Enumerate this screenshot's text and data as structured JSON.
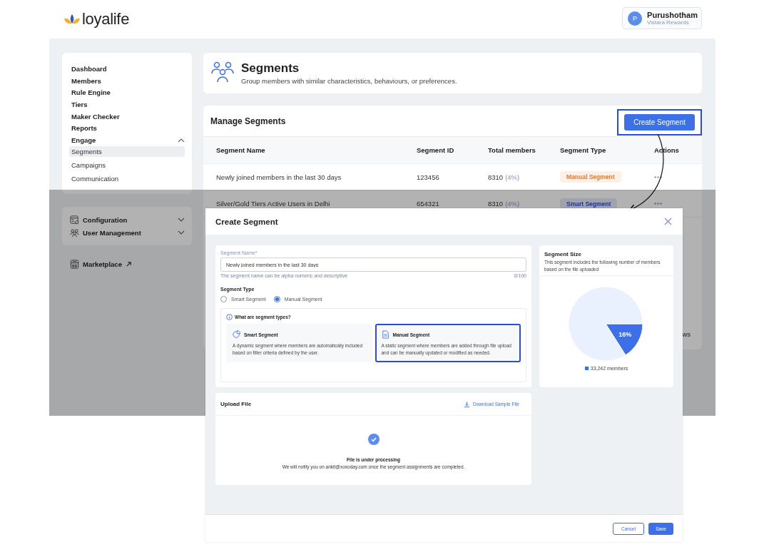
{
  "header": {
    "logo": "loyalife",
    "user": {
      "initial": "P",
      "name": "Purushotham",
      "org": "Vistara Rewards"
    }
  },
  "sidebar": {
    "items": [
      {
        "label": "Dashboard"
      },
      {
        "label": "Members"
      },
      {
        "label": "Rule Engine"
      },
      {
        "label": "Tiers"
      },
      {
        "label": "Maker Checker"
      },
      {
        "label": "Reports"
      },
      {
        "label": "Engage",
        "expanded": true,
        "children": [
          {
            "label": "Segments",
            "selected": true
          },
          {
            "label": "Campaigns",
            "selected": false
          },
          {
            "label": "Communication",
            "selected": false
          }
        ]
      }
    ],
    "settings": [
      {
        "label": "Configuration",
        "kind": "config",
        "expanded": false
      },
      {
        "label": "User Management",
        "kind": "users",
        "expanded": false
      }
    ],
    "marketplace": "Marketplace"
  },
  "page": {
    "title": "Segments",
    "subtitle": "Group members with similar characteristics, behaviours, or preferences."
  },
  "table": {
    "title": "Manage Segments",
    "create_button": "Create Segment",
    "columns": [
      "Segment Name",
      "Segment ID",
      "Total members",
      "Segment Type",
      "Actions"
    ],
    "rows": [
      {
        "name": "Newly joined members in the last 30 days",
        "id": "123456",
        "total": "8310",
        "share": "(4%)",
        "type": {
          "kind": "manual",
          "label": "Manual Segment"
        }
      },
      {
        "name": "Silver/Gold Tiers Active Users in Delhi",
        "id": "654321",
        "total": "8310",
        "share": "(4%)",
        "type": {
          "kind": "smart",
          "label": "Smart Segment"
        }
      }
    ],
    "footer_fragment": "ws"
  },
  "modal": {
    "title": "Create Segment",
    "name_field": {
      "label": "Segment Name*",
      "value": "Newly joined members in the last 30 days",
      "hint": "The segment name can be alpha numeric and descriptive",
      "counter": "0/100"
    },
    "type_label": "Segment Type",
    "type_options": [
      {
        "label": "Smart Segment",
        "selected": false
      },
      {
        "label": "Manual Segment",
        "selected": true
      }
    ],
    "info_title": "What are segment types?",
    "type_cards": [
      {
        "kind": "smart",
        "title": "Smart Segment",
        "text": "A dynamic segment where members are automatically included based on filter criteria defined by the user.",
        "selected": false
      },
      {
        "kind": "manual",
        "title": "Manual Segment",
        "text": "A static segment where members are added through file upload and can be manually updated or modified as needed.",
        "selected": true
      }
    ],
    "size": {
      "title": "Segment Size",
      "text": "This segment includes the following number of members based on the file uploaded",
      "chart_data": {
        "type": "pie",
        "values": [
          16,
          84
        ],
        "value_labels": [
          "16%",
          null
        ]
      },
      "legend": "33,242 members"
    },
    "upload": {
      "title": "Upload File",
      "download": "Download Sample File",
      "status_title": "File is under processing",
      "status_text": "We will notify you on ankit@xoxoday.com once the segment assignments are completed."
    },
    "buttons": [
      {
        "kind": "secondary",
        "label": "Cancel"
      },
      {
        "kind": "primary",
        "label": "Save"
      }
    ]
  }
}
